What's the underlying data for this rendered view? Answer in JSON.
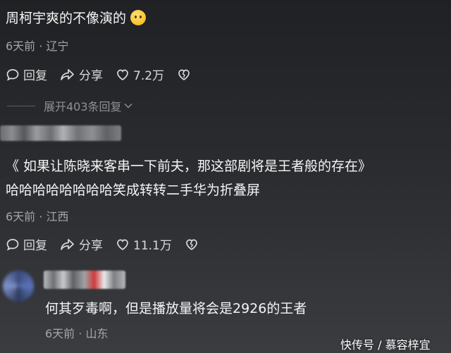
{
  "comments": [
    {
      "text": "周柯宇爽的不像演的",
      "emoji": "thinking-face-emoji",
      "meta": "6天前 · 辽宁",
      "reply_label": "回复",
      "share_label": "分享",
      "likes": "7.2万"
    },
    {
      "text_line1": "《 如果让陈晓来客串一下前夫，那这部剧将是王者般的存在》",
      "text_line2": "哈哈哈哈哈哈哈哈笑成转转二手华为折叠屏",
      "meta": "6天前 · 江西",
      "reply_label": "回复",
      "share_label": "分享",
      "likes": "11.1万"
    },
    {
      "text": "何其歹毒啊，但是播放量将会是2926的王者",
      "meta": "6天前 · 山东"
    }
  ],
  "expand_replies": "展开403条回复",
  "watermark": "快传号 / 慕容梓宜",
  "colors": {
    "background": "#26282b",
    "text": "#f5f5f5",
    "meta": "#a3a5a8"
  }
}
